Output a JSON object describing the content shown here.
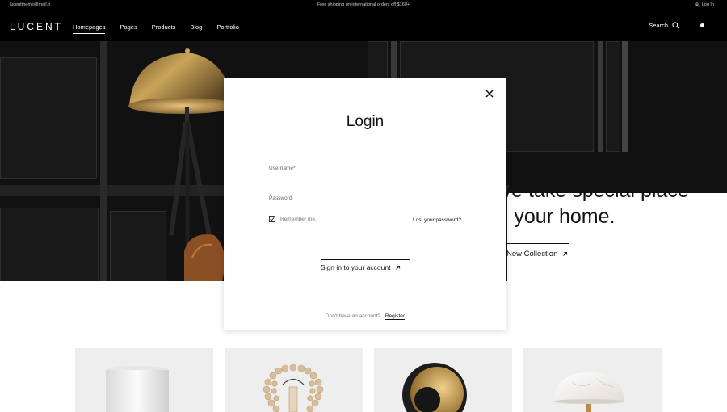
{
  "topbar": {
    "email": "lucenttheme@mail.it",
    "shipping": "Free shipping on international orders off $160+",
    "login": "Log In"
  },
  "nav": {
    "logo": "LUCENT",
    "items": [
      {
        "label": "Homepages",
        "active": true
      },
      {
        "label": "Pages"
      },
      {
        "label": "Products"
      },
      {
        "label": "Blog"
      },
      {
        "label": "Portfolio"
      }
    ],
    "search": "Search"
  },
  "hero": {
    "headline_line1": "We take special place",
    "headline_line2": "in your home.",
    "cta": "New Collection"
  },
  "modal": {
    "title": "Login",
    "username_placeholder": "Username*",
    "password_placeholder": "Password",
    "remember": "Remember me.",
    "lost_password": "Lost your password?",
    "signin": "Sign in to your account",
    "no_account": "Don't have an account?",
    "register": "Register"
  },
  "colors": {
    "topbar": "#000000",
    "navbar": "#000000",
    "hero_dark": "#111111",
    "card_bg": "#eeeeee",
    "accent_gold": "#a8853f"
  },
  "products": [
    {
      "icon": "cylinder-lamp-icon"
    },
    {
      "icon": "bead-necklace-icon"
    },
    {
      "icon": "dome-lamp-icon"
    },
    {
      "icon": "marble-lamp-icon"
    }
  ]
}
